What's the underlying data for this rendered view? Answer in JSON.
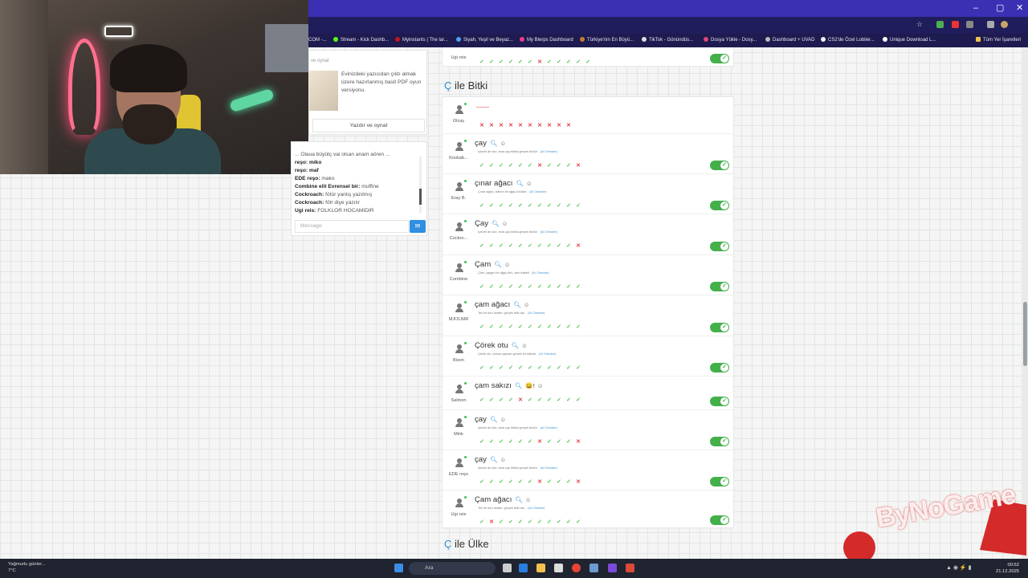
{
  "browser": {
    "bookmarks": [
      "COM -...",
      "Stream - Kick Dashb...",
      "Myinstants | The lar...",
      "Siyah, Yeşil ve Beyaz...",
      "My Blerps Dashboard",
      "Türkiye'nin En Büyü...",
      "TikTok - Gönündüs...",
      "Dosya Yükle - Dosy...",
      "Dashboard + UVAD",
      "CS2'de Özel Lobiler...",
      "Unique Download L...",
      "Tüm Yer İşaretleri"
    ],
    "window_controls": [
      "–",
      "▢",
      "✕"
    ]
  },
  "promo": {
    "heading": "ve oynat",
    "description": "Evinizdeki yazıcıdan çıktı almak üzere hazırlanmış basit PDF oyun versiyonu.",
    "button": "Yazdır ve oynat"
  },
  "chat": {
    "messages": [
      {
        "user": "",
        "text": "... Olaua büyütç vai olsan anam aören ..."
      },
      {
        "user": "",
        "text": "reşo: miko"
      },
      {
        "user": "",
        "text": "reşo: maf"
      },
      {
        "user": "EDE reşo:",
        "text": "mako"
      },
      {
        "user": "Combine elit Evrensel bir:",
        "text": "muffine"
      },
      {
        "user": "Cockroach:",
        "text": "fötür yanlış yazılmış"
      },
      {
        "user": "Cockroach:",
        "text": "fötr diye yazılır"
      },
      {
        "user": "Ugi reis:",
        "text": "FOLKLOR HOCAMIDIR"
      }
    ],
    "placeholder": "Message"
  },
  "previous_row": {
    "user": "Ugi reis",
    "marks": [
      "ok",
      "ok",
      "ok",
      "ok",
      "ok",
      "ok",
      "no",
      "ok",
      "ok",
      "ok",
      "ok",
      "ok"
    ]
  },
  "sections": [
    {
      "letter": "Ç",
      "title": "ile Bitki"
    },
    {
      "letter": "Ç",
      "title": "ile Ülke"
    }
  ],
  "rows": [
    {
      "user": "Olcay",
      "word": "",
      "note": "",
      "marks": [
        "no",
        "no",
        "no",
        "no",
        "no",
        "no",
        "no",
        "no",
        "no",
        "no"
      ],
      "toggle": false,
      "empty": true
    },
    {
      "user": "Kookab...",
      "word": "çay",
      "note": "İçecek de olur, ama çay bitkisi gerçek türdür.",
      "marks": [
        "ok",
        "ok",
        "ok",
        "ok",
        "ok",
        "ok",
        "no",
        "ok",
        "ok",
        "ok",
        "no"
      ],
      "toggle": true
    },
    {
      "user": "Eray B.",
      "word": "çınar ağacı",
      "note": "Çınar ağacı, bilinen bir ağaç türüdür.",
      "marks": [
        "ok",
        "ok",
        "ok",
        "ok",
        "ok",
        "ok",
        "ok",
        "ok",
        "ok",
        "ok",
        "ok"
      ],
      "toggle": true
    },
    {
      "user": "Cockro...",
      "word": "Çay",
      "note": "İçecek de olur, ama çay bitkisi gerçek türdür.",
      "marks": [
        "ok",
        "ok",
        "ok",
        "ok",
        "ok",
        "ok",
        "ok",
        "ok",
        "ok",
        "ok",
        "no"
      ],
      "toggle": true
    },
    {
      "user": "Combine",
      "word": "Çam",
      "note": "Çam, yaygın bir ağaç türü, tam isabet!",
      "marks": [
        "ok",
        "ok",
        "ok",
        "ok",
        "ok",
        "ok",
        "ok",
        "ok",
        "ok",
        "ok",
        "ok"
      ],
      "toggle": true
    },
    {
      "user": "MJOLNIR",
      "word": "çam ağacı",
      "note": "Tek bir türü anlatır; gerçek bitki adı.",
      "marks": [
        "ok",
        "ok",
        "ok",
        "ok",
        "ok",
        "ok",
        "ok",
        "ok",
        "ok",
        "ok",
        "ok"
      ],
      "toggle": true
    },
    {
      "user": "Bison",
      "word": "Çörek otu",
      "note": "Çörek otu, tohum yapılan gerçek bir bitkidir.",
      "marks": [
        "ok",
        "ok",
        "ok",
        "ok",
        "ok",
        "ok",
        "ok",
        "ok",
        "ok",
        "ok",
        "ok"
      ],
      "toggle": true
    },
    {
      "user": "Salmon",
      "word": "çam sakızı",
      "note": "",
      "badge": "😄!",
      "marks": [
        "ok",
        "ok",
        "ok",
        "ok",
        "no",
        "ok",
        "ok",
        "ok",
        "ok",
        "ok",
        "ok"
      ],
      "toggle": true
    },
    {
      "user": "Mink",
      "word": "çay",
      "note": "İçecek de olur, ama çay bitkisi gerçek türdür.",
      "marks": [
        "ok",
        "ok",
        "ok",
        "ok",
        "ok",
        "ok",
        "no",
        "ok",
        "ok",
        "ok",
        "no"
      ],
      "toggle": true
    },
    {
      "user": "EDE reşo",
      "word": "çay",
      "note": "İçecek de olur, ama çay bitkisi gerçek türdür.",
      "marks": [
        "ok",
        "ok",
        "ok",
        "ok",
        "ok",
        "ok",
        "no",
        "ok",
        "ok",
        "ok",
        "no"
      ],
      "toggle": true
    },
    {
      "user": "Ugi reis",
      "word": "Çam ağacı",
      "note": "Tek bir türü anlatır; gerçek bitki adı.",
      "marks": [
        "ok",
        "no",
        "ok",
        "ok",
        "ok",
        "ok",
        "ok",
        "ok",
        "ok",
        "ok",
        "ok"
      ],
      "toggle": true
    }
  ],
  "ai_label": "(AI Checker)",
  "watermark": "ByNoGame",
  "taskbar": {
    "weather_title": "Yağmurlu günler...",
    "weather_temp": "7°C",
    "search": "Ara",
    "time": "00:52",
    "date": "21.12.2025"
  }
}
